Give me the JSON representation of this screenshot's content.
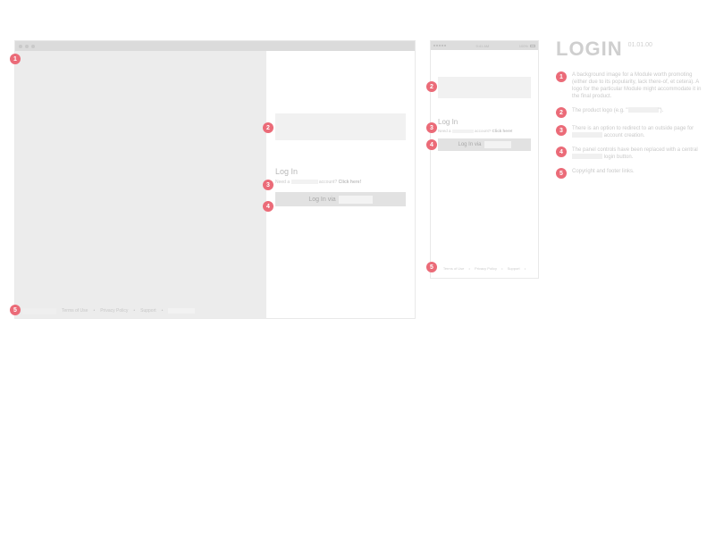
{
  "screen": {
    "title": "LOGIN",
    "version": "01.01.00"
  },
  "desktop": {
    "login_heading": "Log In",
    "need_account_prefix": "Need a ",
    "need_account_suffix": " account?",
    "click_here": "Click here!",
    "login_button_prefix": "Log In via ",
    "footer": {
      "terms": "Terms of Use",
      "privacy": "Privacy Policy",
      "support": "Support"
    }
  },
  "mobile": {
    "status_time": "9:41 AM",
    "status_pct": "100%",
    "login_heading": "Log In",
    "need_account_prefix": "Need a ",
    "need_account_suffix": " account?",
    "click_here": "Click here!",
    "login_button_prefix": "Log In via ",
    "footer": {
      "terms": "Terms of Use",
      "privacy": "Privacy Policy",
      "support": "Support"
    }
  },
  "annotations": [
    {
      "n": "1",
      "text_a": "A background image for a Module worth promoting (either due to its popularity, lack there-of, et cetera). A logo for the particular Module might accommodate it in the final product."
    },
    {
      "n": "2",
      "text_a": "The product logo (e.g. \"",
      "text_b": "\")."
    },
    {
      "n": "3",
      "text_a": "There is an option to redirect to an outside page for ",
      "text_b": " account creation."
    },
    {
      "n": "4",
      "text_a": "The panel controls have been replaced with a central ",
      "text_b": " login button."
    },
    {
      "n": "5",
      "text_a": "Copyright and footer links."
    }
  ]
}
